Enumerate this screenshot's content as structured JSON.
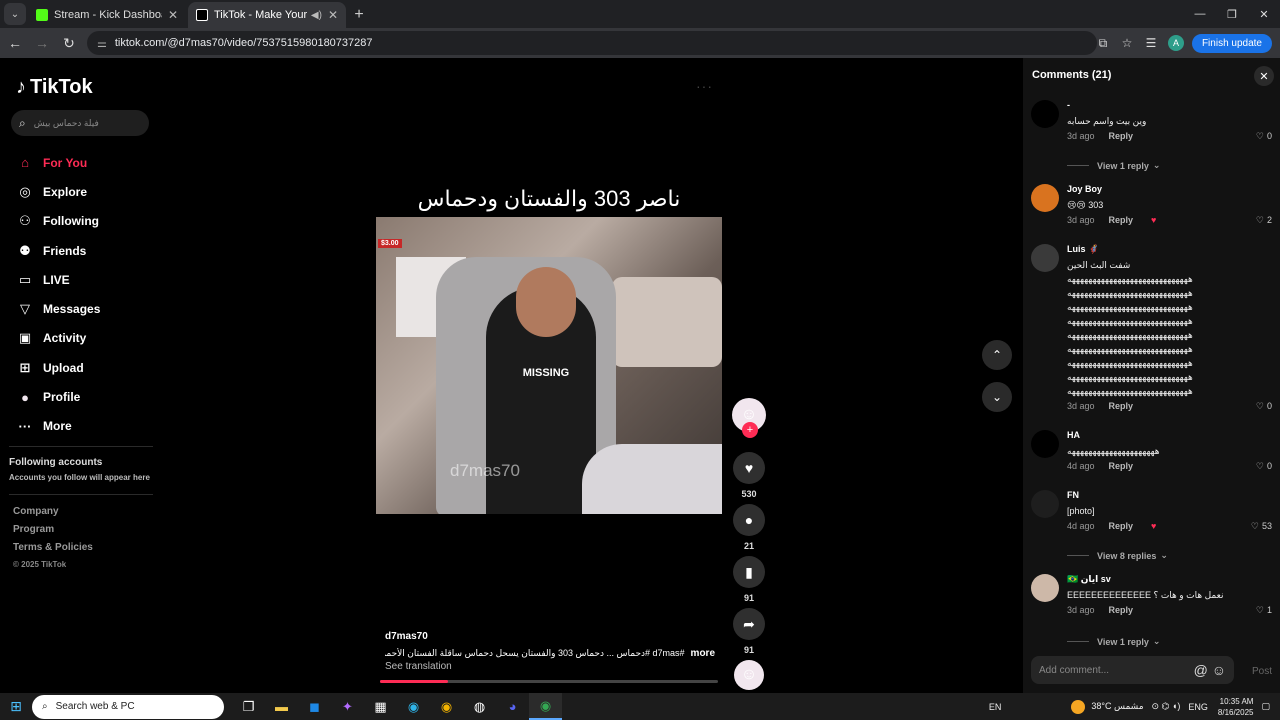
{
  "browser": {
    "tabs": [
      {
        "title": "Stream - Kick Dashboard",
        "active": false,
        "fav_color": "#53fc18"
      },
      {
        "title": "TikTok - Make Your Day",
        "active": true,
        "fav_color": "#ffffff"
      }
    ],
    "url": "tiktok.com/@d7mas70/video/7537515980180737287",
    "profile_initial": "A",
    "finish_update": "Finish update"
  },
  "sidebar": {
    "logo": "TikTok",
    "search_placeholder": "فيلة دحماس بيش",
    "nav": [
      {
        "label": "For You",
        "icon": "home-icon",
        "glyph": "⌂",
        "active": true
      },
      {
        "label": "Explore",
        "icon": "compass-icon",
        "glyph": "◎",
        "active": false
      },
      {
        "label": "Following",
        "icon": "following-icon",
        "glyph": "⚇",
        "active": false
      },
      {
        "label": "Friends",
        "icon": "friends-icon",
        "glyph": "⚉",
        "active": false
      },
      {
        "label": "LIVE",
        "icon": "live-icon",
        "glyph": "▭",
        "active": false
      },
      {
        "label": "Messages",
        "icon": "messages-icon",
        "glyph": "▽",
        "active": false
      },
      {
        "label": "Activity",
        "icon": "activity-icon",
        "glyph": "▣",
        "active": false
      },
      {
        "label": "Upload",
        "icon": "upload-icon",
        "glyph": "⊞",
        "active": false
      },
      {
        "label": "Profile",
        "icon": "profile-icon",
        "glyph": "●",
        "active": false
      },
      {
        "label": "More",
        "icon": "more-icon",
        "glyph": "···",
        "active": false
      }
    ],
    "following_accounts_title": "Following accounts",
    "following_accounts_sub": "Accounts you follow will appear here",
    "footer": [
      "Company",
      "Program",
      "Terms & Policies"
    ],
    "copyright": "© 2025 TikTok"
  },
  "video": {
    "title": "ناصر 303 والفستان ودحماس",
    "price_badge": "$3.00",
    "shirt_text": "MISSING",
    "watermark": "d7mas70",
    "author": "d7mas70",
    "description": "#d7mas #دحماس ... دحماس 303 والفستان يسحل دحماس ساقلة الفستان الأحمر حند دحماس",
    "more_label": "more",
    "see_translation": "See translation",
    "progress": 0.2,
    "likes": "530",
    "comments": "21",
    "saves": "91",
    "shares": "91"
  },
  "comments": {
    "title": "Comments (21)",
    "items": [
      {
        "user": "-",
        "text": "وين بيت واسم حسابه",
        "time": "3d ago",
        "likes": "0",
        "av": "#000000",
        "creator_liked": false,
        "view_replies": "View 1 reply"
      },
      {
        "user": "Joy Boy",
        "text": "303 😢😢",
        "time": "3d ago",
        "likes": "2",
        "av": "#d9731f",
        "creator_liked": true,
        "view_replies": ""
      },
      {
        "user": "Luis 🦸",
        "text": "شفت البث الحين\nهههههههههههههههههههههههههههههه\nهههههههههههههههههههههههههههههه\nهههههههههههههههههههههههههههههه\nهههههههههههههههههههههههههههههه\nهههههههههههههههههههههههههههههه\nهههههههههههههههههههههههههههههه\nهههههههههههههههههههههههههههههه\nهههههههههههههههههههههههههههههه\nهههههههههههههههههههههههههههههه",
        "time": "3d ago",
        "likes": "0",
        "av": "#3a3a3a",
        "creator_liked": false,
        "view_replies": ""
      },
      {
        "user": "HA",
        "text": "هههههههههههههههههههههه",
        "time": "4d ago",
        "likes": "0",
        "av": "#000000",
        "creator_liked": false,
        "view_replies": ""
      },
      {
        "user": "FN",
        "text": "[photo]",
        "time": "4d ago",
        "likes": "53",
        "av": "#1e1e1e",
        "creator_liked": true,
        "view_replies": "View 8 replies"
      },
      {
        "user": "🇧🇷 ايان sv",
        "text": "نعمل هات و هات ؟ EEEEEEEEEEEEEE",
        "time": "3d ago",
        "likes": "1",
        "av": "#cdb8a8",
        "creator_liked": false,
        "view_replies": "View 1 reply"
      }
    ],
    "add_placeholder": "Add comment...",
    "post_label": "Post"
  },
  "taskbar": {
    "search_label": "Search web & PC",
    "lang": "EN",
    "weather": "38°C مشمس",
    "input_lang": "ENG",
    "time": "10:35 AM",
    "date": "8/16/2025"
  }
}
